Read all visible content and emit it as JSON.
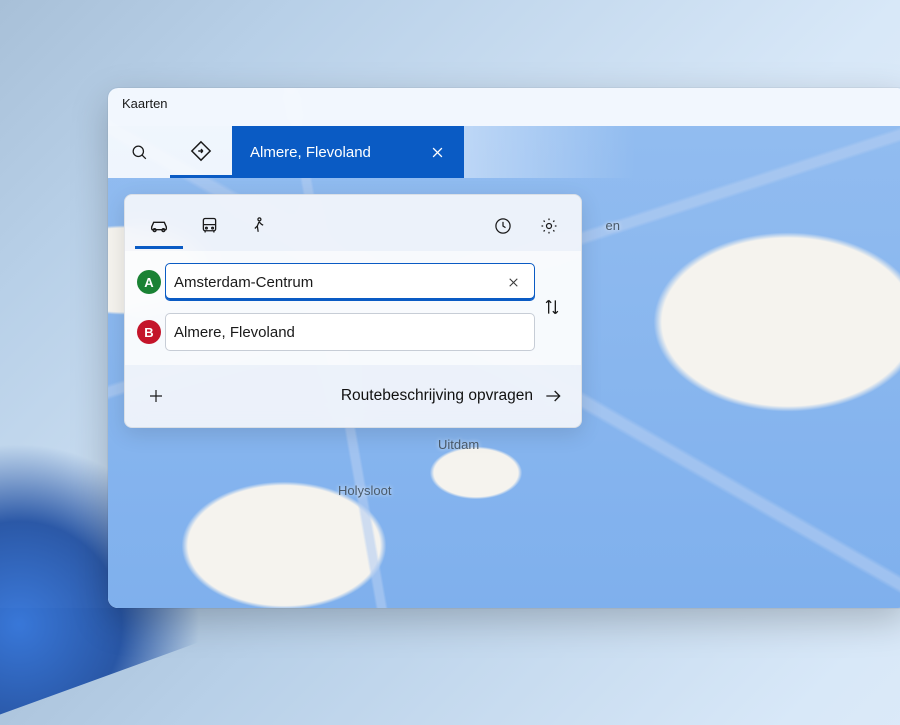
{
  "app": {
    "title": "Kaarten"
  },
  "header": {
    "tab_label": "Almere, Flevoland"
  },
  "waypoints": {
    "a_badge": "A",
    "b_badge": "B",
    "origin": "Amsterdam-Centrum",
    "destination": "Almere, Flevoland"
  },
  "cta": {
    "label": "Routebeschrijving opvragen"
  },
  "map_labels": {
    "holysloot": "Holysloot",
    "uitdam": "Uitdam",
    "east": "en"
  },
  "colors": {
    "accent": "#0a5bc4",
    "badge_a": "#1a8234",
    "badge_b": "#c4142a"
  }
}
